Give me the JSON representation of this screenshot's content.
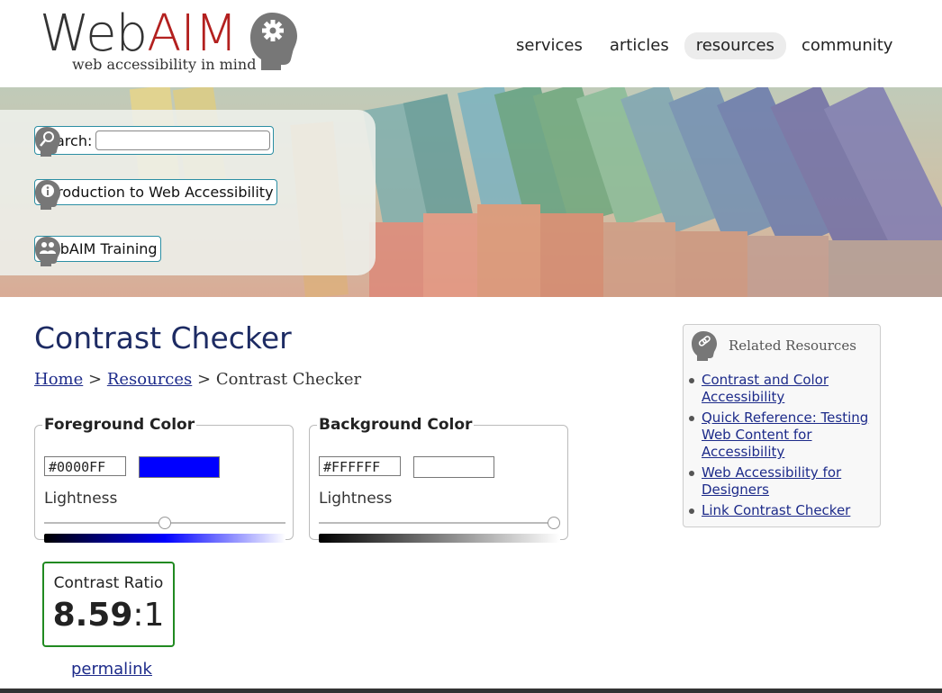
{
  "logo": {
    "brand_web": "Web",
    "brand_aim": "AIM",
    "tagline": "web accessibility in mind"
  },
  "nav": {
    "items": [
      "services",
      "articles",
      "resources",
      "community"
    ],
    "active": "resources"
  },
  "quick_links": {
    "search_label": "Search:",
    "search_value": "",
    "intro_label": "Introduction to Web Accessibility",
    "training_label": "WebAIM Training"
  },
  "page": {
    "title": "Contrast Checker",
    "breadcrumb": {
      "home": "Home",
      "sep": ">",
      "resources": "Resources",
      "current": "Contrast Checker"
    }
  },
  "foreground": {
    "legend": "Foreground Color",
    "hex": "#0000FF",
    "swatch_color": "#0000ff",
    "lightness_label": "Lightness",
    "lightness": 0.5
  },
  "background": {
    "legend": "Background Color",
    "hex": "#FFFFFF",
    "swatch_color": "#ffffff",
    "lightness_label": "Lightness",
    "lightness": 1.0
  },
  "contrast": {
    "label": "Contrast Ratio",
    "value": "8.59",
    "suffix": ":1"
  },
  "permalink_label": "permalink",
  "related": {
    "title": "Related Resources",
    "links": [
      "Contrast and Color Accessibility",
      "Quick Reference: Testing Web Content for Accessibility",
      "Web Accessibility for Designers",
      "Link Contrast Checker"
    ]
  },
  "colors": {
    "brand_red": "#b3201f",
    "title_navy": "#1d2b63",
    "link_blue": "#1d2b8a",
    "ratio_border_green": "#218a21",
    "quick_border_teal": "#2b8ea3"
  },
  "icons": [
    "gear-head-icon",
    "search-head-icon",
    "info-head-icon",
    "people-head-icon",
    "link-head-icon",
    "magnifier-icon"
  ]
}
